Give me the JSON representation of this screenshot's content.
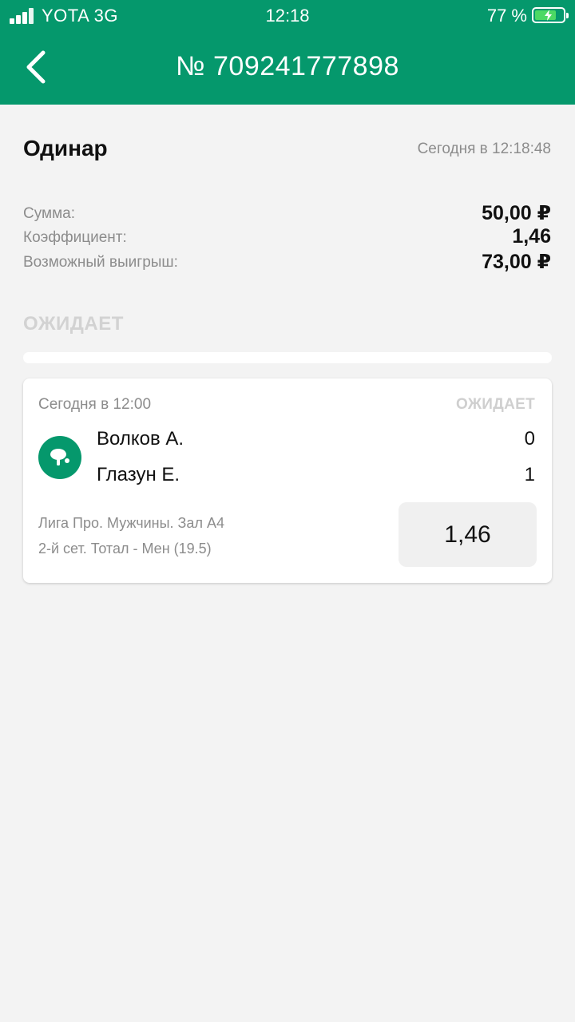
{
  "status_bar": {
    "carrier": "YOTA  3G",
    "time": "12:18",
    "battery": "77 %",
    "battery_level": 0.77
  },
  "header": {
    "title": "№ 709241777898",
    "back_icon": "chevron-left-icon",
    "bg_color": "#05986c"
  },
  "bet": {
    "type": "Одинар",
    "date": "Сегодня в 12:18:48",
    "amount_label": "Сумма:",
    "amount_value": "50,00 ₽",
    "coef_label": "Коэффициент:",
    "coef_value": "1,46",
    "win_label": "Возможный выигрыш:",
    "win_value": "73,00 ₽",
    "status": "ОЖИДАЕТ"
  },
  "event": {
    "time": "Сегодня в 12:00",
    "status": "ОЖИДАЕТ",
    "sport_icon": "table-tennis-icon",
    "team1": "Волков А.",
    "score1": "0",
    "team2": "Глазун Е.",
    "score2": "1",
    "league": "Лига Про. Мужчины. Зал А4",
    "market": "2-й сет. Тотал - Мен (19.5)",
    "odd": "1,46"
  }
}
